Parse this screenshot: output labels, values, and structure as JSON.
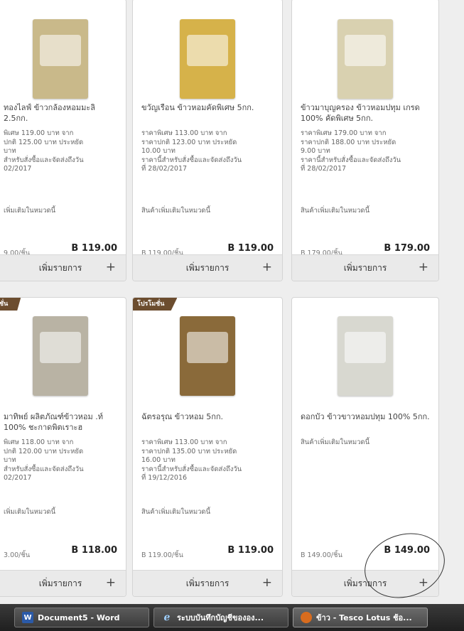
{
  "products": [
    {
      "name": "ทองไลฟ์ ข้าวกล้องหอมมะลิ 2.5กก.",
      "promo": "พิเศษ 119.00 บาท จาก\nปกติ 125.00 บาท ประหยัด\nบาท\nสำหรับสั่งซื้อและจัดส่งถึงวัน\n02/2017",
      "more": "เพิ่มเติมในหมวดนี้",
      "unit_price": "9.00/ชิ้น",
      "price": "B 119.00",
      "add_label": "เพิ่มรายการ",
      "badge": "",
      "bag_color": "#c9b98a"
    },
    {
      "name": "ขวัญเรือน ข้าวหอมคัดพิเศษ 5กก.",
      "promo": "ราคาพิเศษ 113.00 บาท จาก\nราคาปกติ 123.00 บาท ประหยัด\n10.00 บาท\nราคานี้สำหรับสั่งซื้อและจัดส่งถึงวัน\nที่ 28/02/2017",
      "more": "สินค้าเพิ่มเติมในหมวดนี้",
      "unit_price": "B 119.00/ชิ้น",
      "price": "B 119.00",
      "add_label": "เพิ่มรายการ",
      "badge": "",
      "bag_color": "#d6b24a"
    },
    {
      "name": "ข้าวมาบุญครอง ข้าวหอมปทุม เกรด 100% คัดพิเศษ 5กก.",
      "promo": "ราคาพิเศษ 179.00 บาท จาก\nราคาปกติ 188.00 บาท ประหยัด\n9.00 บาท\nราคานี้สำหรับสั่งซื้อและจัดส่งถึงวัน\nที่ 28/02/2017",
      "more": "สินค้าเพิ่มเติมในหมวดนี้",
      "unit_price": "B 179.00/ชิ้น",
      "price": "B 179.00",
      "add_label": "เพิ่มรายการ",
      "badge": "",
      "bag_color": "#d9d1b0"
    },
    {
      "name": "มาทิพย์ ผลิตภัณฑ์ข้าวหอม .ท์ 100% ชะกาดพิตเราะฮ",
      "promo": "พิเศษ 118.00 บาท จาก\nปกติ 120.00 บาท ประหยัด\nบาท\nสำหรับสั่งซื้อและจัดส่งถึงวัน\n02/2017",
      "more": "เพิ่มเติมในหมวดนี้",
      "unit_price": "3.00/ชิ้น",
      "price": "B 118.00",
      "add_label": "เพิ่มรายการ",
      "badge": "ชั่น",
      "bag_color": "#b9b3a4"
    },
    {
      "name": "ฉัตรอรุณ ข้าวหอม 5กก.",
      "promo": "ราคาพิเศษ 113.00 บาท จาก\nราคาปกติ 135.00 บาท ประหยัด\n16.00 บาท\nราคานี้สำหรับสั่งซื้อและจัดส่งถึงวัน\nที่ 19/12/2016",
      "more": "สินค้าเพิ่มเติมในหมวดนี้",
      "unit_price": "B 119.00/ชิ้น",
      "price": "B 119.00",
      "add_label": "เพิ่มรายการ",
      "badge": "โปรโมชั่น",
      "bag_color": "#8a6a3a"
    },
    {
      "name": "ดอกบัว ข้าวขาวหอมปทุม 100% 5กก.",
      "promo": "สินค้าเพิ่มเติมในหมวดนี้",
      "more": "",
      "unit_price": "B 149.00/ชิ้น",
      "price": "B 149.00",
      "add_label": "เพิ่มรายการ",
      "badge": "",
      "bag_color": "#d8d8d0"
    }
  ],
  "taskbar": [
    {
      "label": "Document5 - Word",
      "icon": "word-icon"
    },
    {
      "label": "ระบบบันทึกบัญชีขององ...",
      "icon": "ie-icon"
    },
    {
      "label": "ข้าว - Tesco Lotus ช้อ...",
      "icon": "firefox-icon"
    }
  ]
}
